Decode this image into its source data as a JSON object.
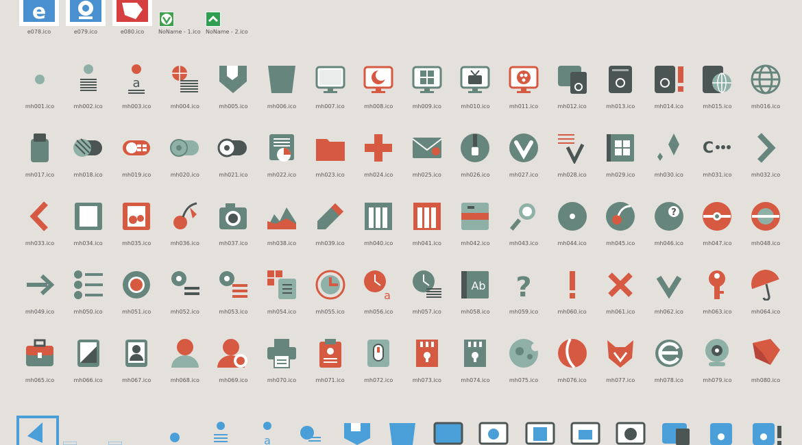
{
  "colors": {
    "background": "#e4e0dc",
    "gray": "#65857d",
    "gray_light": "#8fb0a6",
    "dark": "#4a5554",
    "red": "#d65a42",
    "blue": "#4a8fcf"
  },
  "top_items": [
    {
      "label": "e078.ico",
      "icon": "ie-e-icon"
    },
    {
      "label": "e079.ico",
      "icon": "webcam-icon"
    },
    {
      "label": "e080.ico",
      "icon": "pointer-icon"
    },
    {
      "label": "NoName - 1.ico",
      "icon": "vivaldi-icon"
    },
    {
      "label": "NoName - 2.ico",
      "icon": "up-arrow-icon"
    }
  ],
  "icons": [
    {
      "label": "mh001.ico",
      "shape": "dot"
    },
    {
      "label": "mh002.ico",
      "shape": "dot-lines"
    },
    {
      "label": "mh003.ico",
      "shape": "dot-a"
    },
    {
      "label": "mh004.ico",
      "shape": "globe-lines"
    },
    {
      "label": "mh005.ico",
      "shape": "shield"
    },
    {
      "label": "mh006.ico",
      "shape": "pentagon"
    },
    {
      "label": "mh007.ico",
      "shape": "monitor"
    },
    {
      "label": "mh008.ico",
      "shape": "monitor-moon"
    },
    {
      "label": "mh009.ico",
      "shape": "monitor-windows"
    },
    {
      "label": "mh010.ico",
      "shape": "monitor-tv"
    },
    {
      "label": "mh011.ico",
      "shape": "monitor-reel"
    },
    {
      "label": "mh012.ico",
      "shape": "pc"
    },
    {
      "label": "mh013.ico",
      "shape": "tower"
    },
    {
      "label": "mh014.ico",
      "shape": "tower-alert"
    },
    {
      "label": "mh015.ico",
      "shape": "tower-globe"
    },
    {
      "label": "mh016.ico",
      "shape": "globe"
    },
    {
      "label": "mh017.ico",
      "shape": "usb"
    },
    {
      "label": "mh018.ico",
      "shape": "drive-striped"
    },
    {
      "label": "mh019.ico",
      "shape": "drive-windows"
    },
    {
      "label": "mh020.ico",
      "shape": "drive-disc"
    },
    {
      "label": "mh021.ico",
      "shape": "drive-reel"
    },
    {
      "label": "mh022.ico",
      "shape": "doc-chart"
    },
    {
      "label": "mh023.ico",
      "shape": "folder"
    },
    {
      "label": "mh024.ico",
      "shape": "plus"
    },
    {
      "label": "mh025.ico",
      "shape": "envelope"
    },
    {
      "label": "mh026.ico",
      "shape": "zip"
    },
    {
      "label": "mh027.ico",
      "shape": "vivaldi"
    },
    {
      "label": "mh028.ico",
      "shape": "lines-v"
    },
    {
      "label": "mh029.ico",
      "shape": "book-windows"
    },
    {
      "label": "mh030.ico",
      "shape": "diamonds"
    },
    {
      "label": "mh031.ico",
      "shape": "c-dots"
    },
    {
      "label": "mh032.ico",
      "shape": "chevron-right"
    },
    {
      "label": "mh033.ico",
      "shape": "chevron-left"
    },
    {
      "label": "mh034.ico",
      "shape": "film"
    },
    {
      "label": "mh035.ico",
      "shape": "film-cherry"
    },
    {
      "label": "mh036.ico",
      "shape": "cherry"
    },
    {
      "label": "mh037.ico",
      "shape": "camera"
    },
    {
      "label": "mh038.ico",
      "shape": "landscape"
    },
    {
      "label": "mh039.ico",
      "shape": "pencil"
    },
    {
      "label": "mh040.ico",
      "shape": "piano"
    },
    {
      "label": "mh041.ico",
      "shape": "piano-red"
    },
    {
      "label": "mh042.ico",
      "shape": "binder"
    },
    {
      "label": "mh043.ico",
      "shape": "magnifier"
    },
    {
      "label": "mh044.ico",
      "shape": "disc"
    },
    {
      "label": "mh045.ico",
      "shape": "disc-cherry"
    },
    {
      "label": "mh046.ico",
      "shape": "disc-question"
    },
    {
      "label": "mh047.ico",
      "shape": "disc-red"
    },
    {
      "label": "mh048.ico",
      "shape": "disc-red-ring"
    },
    {
      "label": "mh049.ico",
      "shape": "arrow-right"
    },
    {
      "label": "mh050.ico",
      "shape": "list"
    },
    {
      "label": "mh051.ico",
      "shape": "gear-red"
    },
    {
      "label": "mh052.ico",
      "shape": "gear-lines"
    },
    {
      "label": "mh053.ico",
      "shape": "gear-lines-red"
    },
    {
      "label": "mh054.ico",
      "shape": "grid-device"
    },
    {
      "label": "mh055.ico",
      "shape": "clock-refresh"
    },
    {
      "label": "mh056.ico",
      "shape": "clock-a"
    },
    {
      "label": "mh057.ico",
      "shape": "clock-lines"
    },
    {
      "label": "mh058.ico",
      "shape": "ab-book"
    },
    {
      "label": "mh059.ico",
      "shape": "question"
    },
    {
      "label": "mh060.ico",
      "shape": "exclaim"
    },
    {
      "label": "mh061.ico",
      "shape": "cross"
    },
    {
      "label": "mh062.ico",
      "shape": "check-v"
    },
    {
      "label": "mh063.ico",
      "shape": "key"
    },
    {
      "label": "mh064.ico",
      "shape": "umbrella"
    },
    {
      "label": "mh065.ico",
      "shape": "briefcase"
    },
    {
      "label": "mh066.ico",
      "shape": "tablet"
    },
    {
      "label": "mh067.ico",
      "shape": "contact-card"
    },
    {
      "label": "mh068.ico",
      "shape": "user"
    },
    {
      "label": "mh069.ico",
      "shape": "user-badge"
    },
    {
      "label": "mh070.ico",
      "shape": "printer"
    },
    {
      "label": "mh071.ico",
      "shape": "badge-red"
    },
    {
      "label": "mh072.ico",
      "shape": "mouse"
    },
    {
      "label": "mh073.ico",
      "shape": "sd-card-red"
    },
    {
      "label": "mh074.ico",
      "shape": "sd-card"
    },
    {
      "label": "mh075.ico",
      "shape": "bubbles"
    },
    {
      "label": "mh076.ico",
      "shape": "ball"
    },
    {
      "label": "mh077.ico",
      "shape": "fox"
    },
    {
      "label": "mh078.ico",
      "shape": "ie-e"
    },
    {
      "label": "mh079.ico",
      "shape": "webcam"
    },
    {
      "label": "mh080.ico",
      "shape": "pointer"
    }
  ],
  "bottom_icons": [
    "photo-icon",
    "dot-icon",
    "dot-lines-icon",
    "dot-a-icon",
    "globe-lines-icon",
    "shield-icon",
    "pentagon-icon",
    "monitor-icon",
    "monitor-moon-icon",
    "monitor-windows-icon",
    "monitor-tv-icon",
    "monitor-reel-icon",
    "pc-icon",
    "tower-icon",
    "tower-alert-icon"
  ]
}
